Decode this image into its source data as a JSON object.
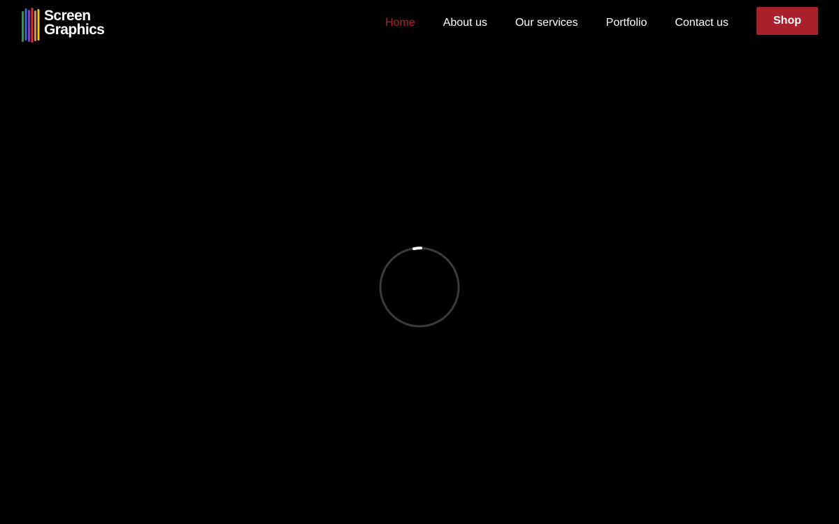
{
  "brand": {
    "logo_line1": "Screen",
    "logo_line2": "Graphics",
    "stripe_colors": [
      "#1f9e5a",
      "#2f6fd6",
      "#7a3fb0",
      "#e0312f",
      "#f08a1c",
      "#f5c518"
    ]
  },
  "nav": {
    "items": [
      {
        "label": "Home",
        "active": true
      },
      {
        "label": "About us",
        "active": false
      },
      {
        "label": "Our services",
        "active": false
      },
      {
        "label": "Portfolio",
        "active": false
      },
      {
        "label": "Contact us",
        "active": false
      }
    ],
    "shop_label": "Shop"
  },
  "colors": {
    "background": "#000000",
    "accent": "#a8212b",
    "active_nav": "#b3202a",
    "spinner_track": "#3a3a3a",
    "spinner_head": "#ffffff"
  },
  "loader": {
    "icon": "loading-spinner-icon"
  }
}
